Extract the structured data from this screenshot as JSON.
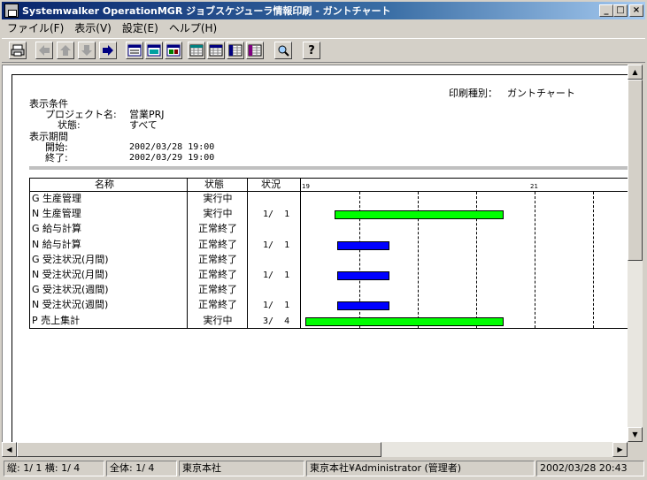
{
  "window": {
    "title": "Systemwalker OperationMGR ジョブスケジューラ情報印刷 - ガントチャート",
    "minimize": "_",
    "maximize": "□",
    "close": "×"
  },
  "menu": [
    "ファイル(F)",
    "表示(V)",
    "設定(E)",
    "ヘルプ(H)"
  ],
  "toolbar": {
    "icons": [
      "printer-icon",
      "arrow-left-icon",
      "arrow-up-icon",
      "arrow-down-icon",
      "arrow-right-icon",
      "view1-icon",
      "view2-icon",
      "view3-icon",
      "grid1-icon",
      "grid2-icon",
      "grid3-icon",
      "grid4-icon",
      "zoom-icon",
      "help-icon"
    ],
    "help_label": "?"
  },
  "report": {
    "print_type_label": "印刷種別：",
    "print_type_value": "ガントチャート",
    "conditions_label": "表示条件",
    "project_label": "プロジェクト名:",
    "project_value": "営業PRJ",
    "state_label": "状態:",
    "state_value": "すべて",
    "period_label": "表示期間",
    "start_label": "開始:",
    "start_value": "2002/03/28 19:00",
    "end_label": "終了:",
    "end_value": "2002/03/29 19:00"
  },
  "table": {
    "headers": [
      "名称",
      "状態",
      "状況"
    ],
    "tick_left": "19",
    "tick_mid": "21",
    "rows": [
      {
        "name": "G 生産管理",
        "state": "実行中",
        "status": "",
        "bar_color": ""
      },
      {
        "name": "N 生産管理",
        "state": "実行中",
        "status": "1/  1",
        "bar_color": "#00ff00",
        "bar_start": 0.1,
        "bar_end": 0.62
      },
      {
        "name": "G 給与計算",
        "state": "正常終了",
        "status": "",
        "bar_color": ""
      },
      {
        "name": "N 給与計算",
        "state": "正常終了",
        "status": "1/  1",
        "bar_color": "#0000ff",
        "bar_start": 0.11,
        "bar_end": 0.27
      },
      {
        "name": "G 受注状況(月間)",
        "state": "正常終了",
        "status": "",
        "bar_color": ""
      },
      {
        "name": "N 受注状況(月間)",
        "state": "正常終了",
        "status": "1/  1",
        "bar_color": "#0000ff",
        "bar_start": 0.11,
        "bar_end": 0.27
      },
      {
        "name": "G 受注状況(週間)",
        "state": "正常終了",
        "status": "",
        "bar_color": ""
      },
      {
        "name": "N 受注状況(週間)",
        "state": "正常終了",
        "status": "1/  1",
        "bar_color": "#0000ff",
        "bar_start": 0.11,
        "bar_end": 0.27
      },
      {
        "name": "P 売上集計",
        "state": "実行中",
        "status": "3/  4",
        "bar_color": "#00ff00",
        "bar_start": 0.01,
        "bar_end": 0.62
      }
    ]
  },
  "statusbar": {
    "position": "縦: 1/ 1 横: 1/ 4",
    "total": "全体:  1/  4",
    "location": "東京本社",
    "user": "東京本社¥Administrator (管理者)",
    "datetime": "2002/03/28 20:43"
  },
  "scroll": {
    "up": "▲",
    "down": "▼",
    "left": "◀",
    "right": "▶"
  }
}
